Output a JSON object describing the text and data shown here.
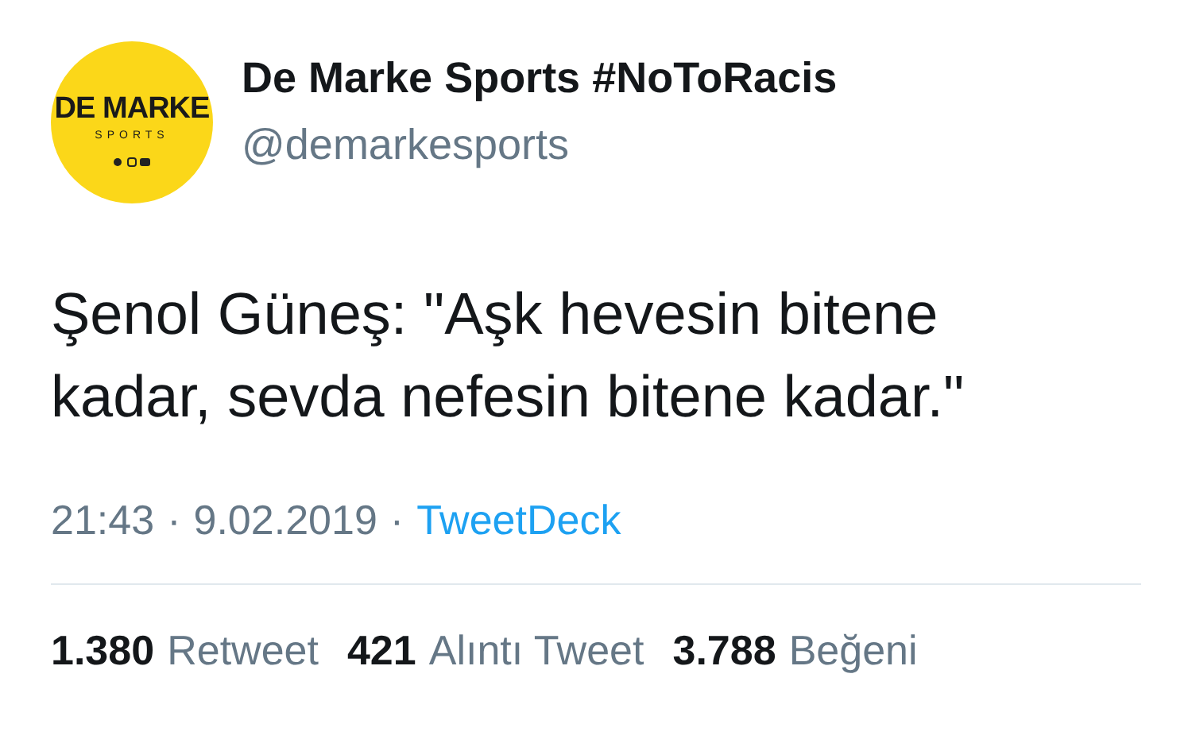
{
  "author": {
    "avatar": {
      "title": "DE MARKE",
      "subtitle": "SPORTS"
    },
    "name": "De Marke Sports #NoToRacis",
    "handle": "@demarkesports"
  },
  "tweet": {
    "text": "Şenol Güneş: \"Aşk hevesin bitene kadar, sevda nefesin bitene kadar.\""
  },
  "meta": {
    "time": "21:43",
    "separator_1": "·",
    "date": "9.02.2019",
    "separator_2": "·",
    "source": "TweetDeck"
  },
  "stats": [
    {
      "count": "1.380",
      "label": "Retweet"
    },
    {
      "count": "421",
      "label": "Alıntı Tweet"
    },
    {
      "count": "3.788",
      "label": "Beğeni"
    }
  ]
}
